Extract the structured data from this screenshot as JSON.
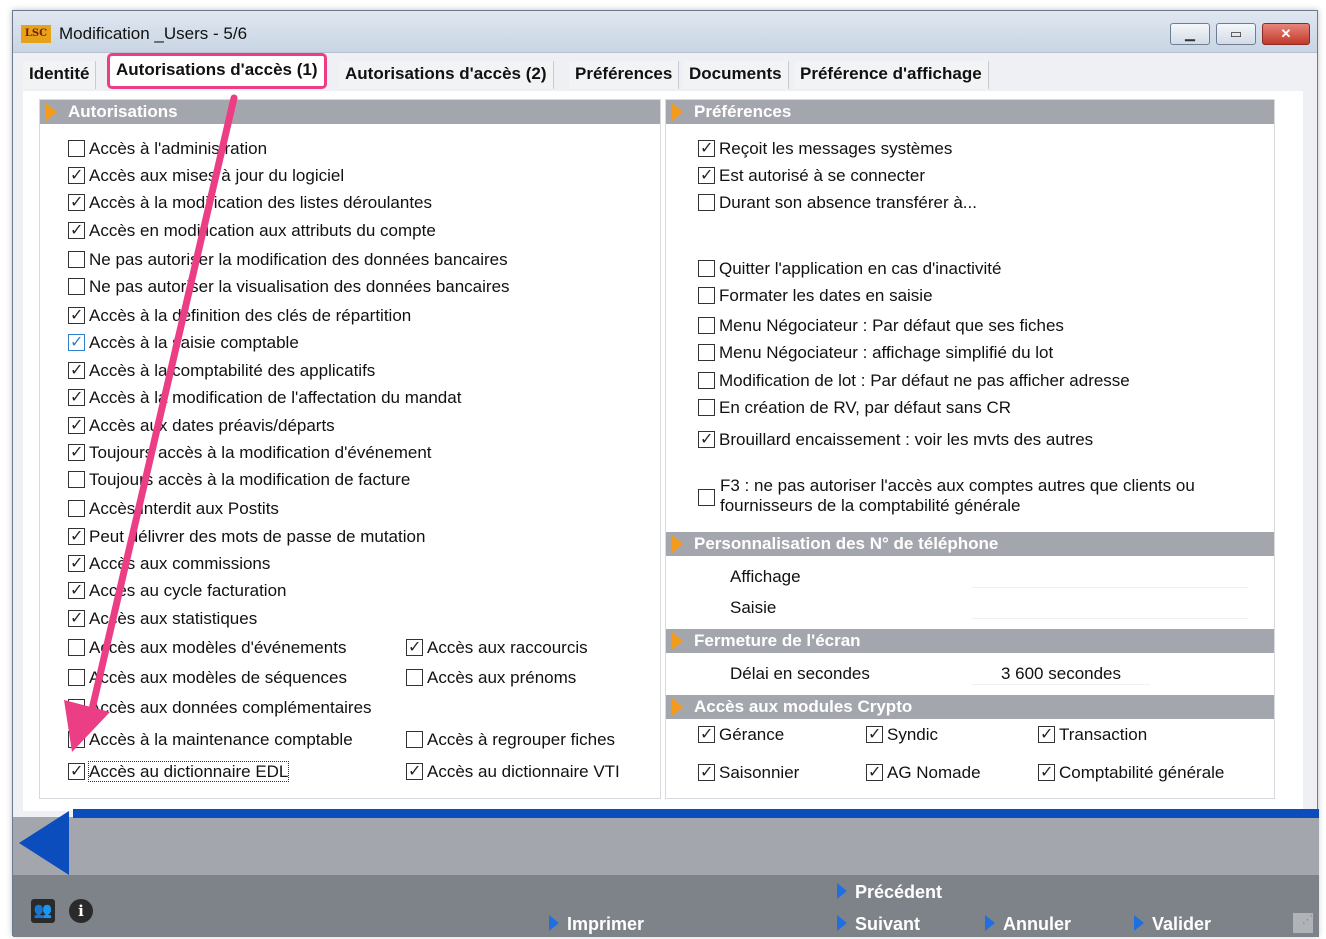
{
  "window": {
    "logo": "LSC",
    "title": "Modification _Users - 5/6",
    "min_symbol": "▁",
    "max_symbol": "▭",
    "close_symbol": "✕"
  },
  "tabs": [
    {
      "label": "Identité"
    },
    {
      "label": "Autorisations d'accès (1)",
      "active": true
    },
    {
      "label": "Autorisations d'accès (2)"
    },
    {
      "label": "Préférences"
    },
    {
      "label": "Documents"
    },
    {
      "label": "Préférence d'affichage"
    }
  ],
  "autorisations": {
    "header": "Autorisations",
    "items": [
      {
        "label": "Accès à l'administration",
        "checked": false
      },
      {
        "label": "Accès aux mises à jour du logiciel",
        "checked": true
      },
      {
        "label": "Accès à la modification des listes déroulantes",
        "checked": true
      },
      {
        "label": "Accès en modification aux attributs du compte",
        "checked": true
      },
      {
        "label": "Ne pas autoriser la modification des données bancaires",
        "checked": false
      },
      {
        "label": "Ne pas autoriser la visualisation des données bancaires",
        "checked": false
      },
      {
        "label": "Accès à la définition des clés de répartition",
        "checked": true
      },
      {
        "label": "Accès à la saisie comptable",
        "checked": true
      },
      {
        "label": "Accès à la comptabilité des applicatifs",
        "checked": true
      },
      {
        "label": "Accès à la modification de l'affectation du mandat",
        "checked": true
      },
      {
        "label": "Accès aux dates préavis/départs",
        "checked": true
      },
      {
        "label": "Toujours accès à la modification d'événement",
        "checked": true
      },
      {
        "label": "Toujours accès à la modification de facture",
        "checked": false
      },
      {
        "label": "Accès interdit aux Postits",
        "checked": false
      },
      {
        "label": "Peut délivrer des mots de passe de mutation",
        "checked": true
      },
      {
        "label": "Accès aux commissions",
        "checked": true
      },
      {
        "label": "Accès au cycle facturation",
        "checked": true
      },
      {
        "label": "Accès aux statistiques",
        "checked": true
      },
      {
        "label": "Accès aux modèles d'événements",
        "checked": false
      },
      {
        "label": "Accès aux modèles de séquences",
        "checked": false
      },
      {
        "label": "Accès aux données complémentaires",
        "checked": false
      },
      {
        "label": "Accès à la maintenance comptable",
        "checked": false
      },
      {
        "label": "Accès au dictionnaire EDL",
        "checked": true
      }
    ],
    "right_items": [
      {
        "label": "Accès aux raccourcis",
        "checked": true
      },
      {
        "label": "Accès aux prénoms",
        "checked": false
      },
      {
        "label": "Accès à regrouper fiches",
        "checked": false
      },
      {
        "label": "Accès au dictionnaire VTI",
        "checked": true
      }
    ]
  },
  "preferences": {
    "header": "Préférences",
    "items": [
      {
        "label": "Reçoit les messages systèmes",
        "checked": true
      },
      {
        "label": "Est autorisé à se connecter",
        "checked": true
      },
      {
        "label": "Durant son absence transférer à...",
        "checked": false
      },
      {
        "label": "Quitter l'application en cas d'inactivité",
        "checked": false
      },
      {
        "label": "Formater les dates en saisie",
        "checked": false
      },
      {
        "label": "Menu Négociateur : Par défaut que ses fiches",
        "checked": false
      },
      {
        "label": "Menu Négociateur : affichage simplifié du lot",
        "checked": false
      },
      {
        "label": "Modification de lot : Par défaut ne pas afficher adresse",
        "checked": false
      },
      {
        "label": "En création de RV, par défaut sans CR",
        "checked": false
      },
      {
        "label": "Brouillard encaissement : voir les mvts des autres",
        "checked": true
      }
    ],
    "f3_line1": "F3 : ne pas autoriser l'accès aux comptes autres que clients ou",
    "f3_line2": "fournisseurs de la comptabilité générale",
    "f3_checked": false
  },
  "telephone": {
    "header": "Personnalisation des N° de téléphone",
    "affichage_label": "Affichage",
    "affichage_value": "",
    "saisie_label": "Saisie",
    "saisie_value": ""
  },
  "fermeture": {
    "header": "Fermeture de l'écran",
    "delai_label": "Délai en secondes",
    "delai_value": "3 600 secondes"
  },
  "crypto": {
    "header": "Accès aux modules Crypto",
    "items": [
      {
        "label": "Gérance",
        "checked": true
      },
      {
        "label": "Syndic",
        "checked": true
      },
      {
        "label": "Transaction",
        "checked": true
      },
      {
        "label": "Saisonnier",
        "checked": true
      },
      {
        "label": "AG Nomade",
        "checked": true
      },
      {
        "label": "Comptabilité générale",
        "checked": true
      }
    ]
  },
  "footer": {
    "precedent": "Précédent",
    "imprimer": "Imprimer",
    "suivant": "Suivant",
    "annuler": "Annuler",
    "valider": "Valider",
    "users_icon_glyph": "👥",
    "info_icon_glyph": "i"
  },
  "colors": {
    "tab_highlight": "#ec3e84",
    "annotation_arrow": "#ec3e84",
    "header_bg": "#a3a7ad",
    "header_arrow": "#f29b1d",
    "footer_accent": "#0c4dbd"
  }
}
